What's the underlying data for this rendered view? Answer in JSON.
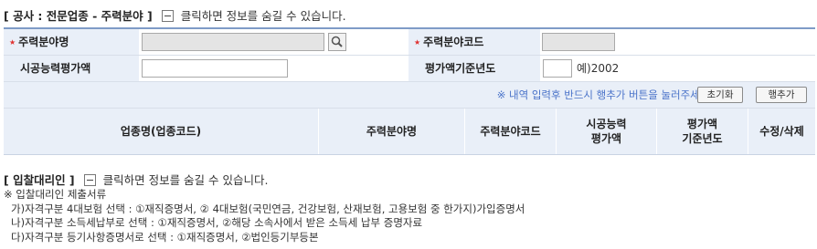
{
  "section1": {
    "title": "[ 공사 : 전문업종 - 주력분야 ]",
    "toggle_text": "클릭하면 정보를 숨길 수 있습니다."
  },
  "form": {
    "main_field_label": "주력분야명",
    "main_field_value": "",
    "main_code_label": "주력분야코드",
    "main_code_value": "",
    "capacity_label": "시공능력평가액",
    "capacity_value": "",
    "base_year_label": "평가액기준년도",
    "base_year_value": "",
    "base_year_example": "예)2002"
  },
  "notice": {
    "text": "※ 내역 입력후 반드시 행추가 버튼을 눌러주세요.",
    "reset_button": "초기화",
    "add_row_button": "행추가"
  },
  "grid": {
    "columns": [
      "업종명(업종코드)",
      "주력분야명",
      "주력분야코드",
      "시공능력\n평가액",
      "평가액\n기준년도",
      "수정/삭제"
    ]
  },
  "section2": {
    "title": "[ 입찰대리인 ]",
    "toggle_text": "클릭하면 정보를 숨길 수 있습니다.",
    "docs_heading": "※ 입찰대리인 제출서류",
    "docs": [
      "가)자격구분 4대보험 선택 : ①재직증명서, ② 4대보험(국민연금, 건강보험, 산재보험, 고용보험 중 한가지)가입증명서",
      "나)자격구분 소득세납부로 선택 : ①재직증명서, ②해당 소속사에서 받은 소득세 납부 증명자료",
      "다)자격구분 등기사항증명서로 선택 : ①재직증명서, ②법인등기부등본"
    ]
  },
  "colors": {
    "accent": "#4a73c9",
    "label_bg": "#e9eff8",
    "required": "#e0302f",
    "border_top": "#7f9bc7"
  },
  "icons": {
    "search": "magnifier-icon",
    "toggle": "minus-box-icon"
  }
}
